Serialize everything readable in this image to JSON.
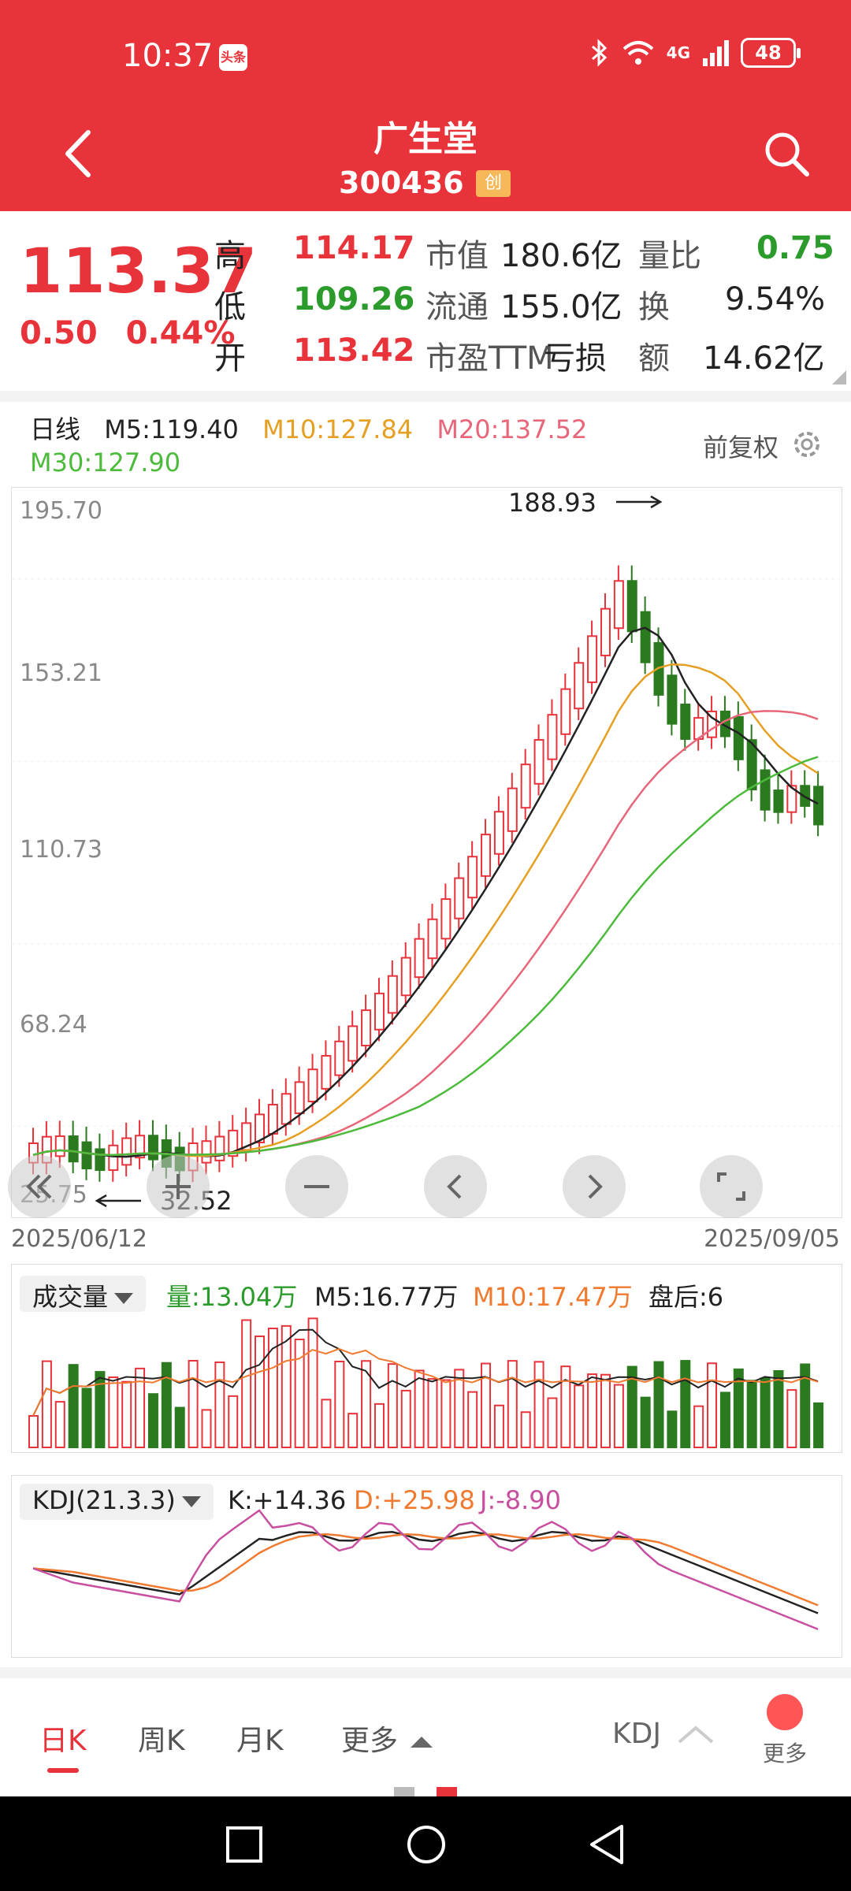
{
  "status_bar": {
    "time": "10:37",
    "badge": "头条",
    "network": "4G",
    "battery": "48"
  },
  "header": {
    "title": "广生堂",
    "code": "300436",
    "board_tag": "创"
  },
  "quote": {
    "price": "113.37",
    "change": "0.50",
    "change_pct": "0.44%",
    "items": [
      {
        "label": "高",
        "value": "114.17",
        "color": "#e8333b"
      },
      {
        "label": "低",
        "value": "109.26",
        "color": "#2b9b2b"
      },
      {
        "label": "开",
        "value": "113.42",
        "color": "#e8333b"
      },
      {
        "label": "市值",
        "value": "180.6亿"
      },
      {
        "label": "流通",
        "value": "155.0亿"
      },
      {
        "label": "市盈TTM",
        "value": "亏损"
      },
      {
        "label": "量比",
        "value": "0.75",
        "color": "#2b9b2b"
      },
      {
        "label": "换",
        "value": "9.54%"
      },
      {
        "label": "额",
        "value": "14.62亿"
      }
    ]
  },
  "ma_bar": {
    "period": "日线",
    "m5": "M5:119.40",
    "m10": "M10:127.84",
    "m20": "M20:137.52",
    "m30": "M30:127.90",
    "adjust": "前复权",
    "colors": {
      "m5": "#222222",
      "m10": "#e5a024",
      "m20": "#e8667a",
      "m30": "#4cbb3c"
    }
  },
  "kline": {
    "y_ticks": [
      "195.70",
      "153.21",
      "110.73",
      "68.24",
      "25.75"
    ],
    "max_label": "188.93",
    "min_label": "32.52",
    "date_start": "2025/06/12",
    "date_end": "2025/09/05"
  },
  "volume": {
    "indicator": "成交量",
    "vol": "量:13.04万",
    "m5": "M5:16.77万",
    "m10": "M10:17.47万",
    "after_hours": "盘后:6"
  },
  "kdj": {
    "indicator": "KDJ(21.3.3)",
    "k": "K:+14.36",
    "d": "D:+25.98",
    "j": "J:-8.90"
  },
  "tabs": {
    "day": "日K",
    "week": "周K",
    "month": "月K",
    "more": "更多",
    "kdj": "KDJ",
    "more_btn": "更多"
  }
}
